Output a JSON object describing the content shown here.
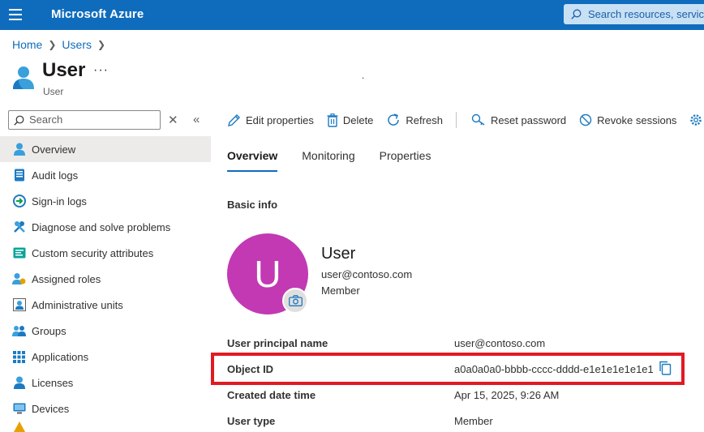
{
  "topbar": {
    "brand": "Microsoft Azure",
    "search_placeholder": "Search resources, services"
  },
  "breadcrumb": [
    "Home",
    "Users"
  ],
  "header": {
    "title": "User",
    "more": "···",
    "subtitle": "User",
    "stray": "."
  },
  "nav": {
    "search_placeholder": "Search",
    "close": "✕",
    "collapse": "«",
    "items": [
      {
        "label": "Overview",
        "icon": "user-icon",
        "active": true
      },
      {
        "label": "Audit logs",
        "icon": "audit-log-icon"
      },
      {
        "label": "Sign-in logs",
        "icon": "sign-in-icon"
      },
      {
        "label": "Diagnose and solve problems",
        "icon": "wrench-icon"
      },
      {
        "label": "Custom security attributes",
        "icon": "attributes-icon"
      },
      {
        "label": "Assigned roles",
        "icon": "roles-icon"
      },
      {
        "label": "Administrative units",
        "icon": "admin-units-icon"
      },
      {
        "label": "Groups",
        "icon": "groups-icon"
      },
      {
        "label": "Applications",
        "icon": "apps-grid-icon"
      },
      {
        "label": "Licenses",
        "icon": "license-icon"
      },
      {
        "label": "Devices",
        "icon": "device-icon"
      }
    ]
  },
  "toolbar": {
    "edit": "Edit properties",
    "delete": "Delete",
    "refresh": "Refresh",
    "reset_password": "Reset password",
    "revoke_sessions": "Revoke sessions"
  },
  "tabs": [
    {
      "label": "Overview",
      "active": true
    },
    {
      "label": "Monitoring"
    },
    {
      "label": "Properties"
    }
  ],
  "basic_info": {
    "title": "Basic info",
    "avatar_initial": "U",
    "name": "User",
    "email": "user@contoso.com",
    "member_type": "Member"
  },
  "properties": [
    {
      "label": "User principal name",
      "value": "user@contoso.com"
    },
    {
      "label": "Object ID",
      "value": "a0a0a0a0-bbbb-cccc-dddd-e1e1e1e1e1e1"
    },
    {
      "label": "Created date time",
      "value": "Apr 15, 2025, 9:26 AM"
    },
    {
      "label": "User type",
      "value": "Member"
    }
  ],
  "colors": {
    "brand_blue": "#0f6cbd",
    "avatar_bg": "#c239b3",
    "highlight_red": "#e11a22"
  }
}
